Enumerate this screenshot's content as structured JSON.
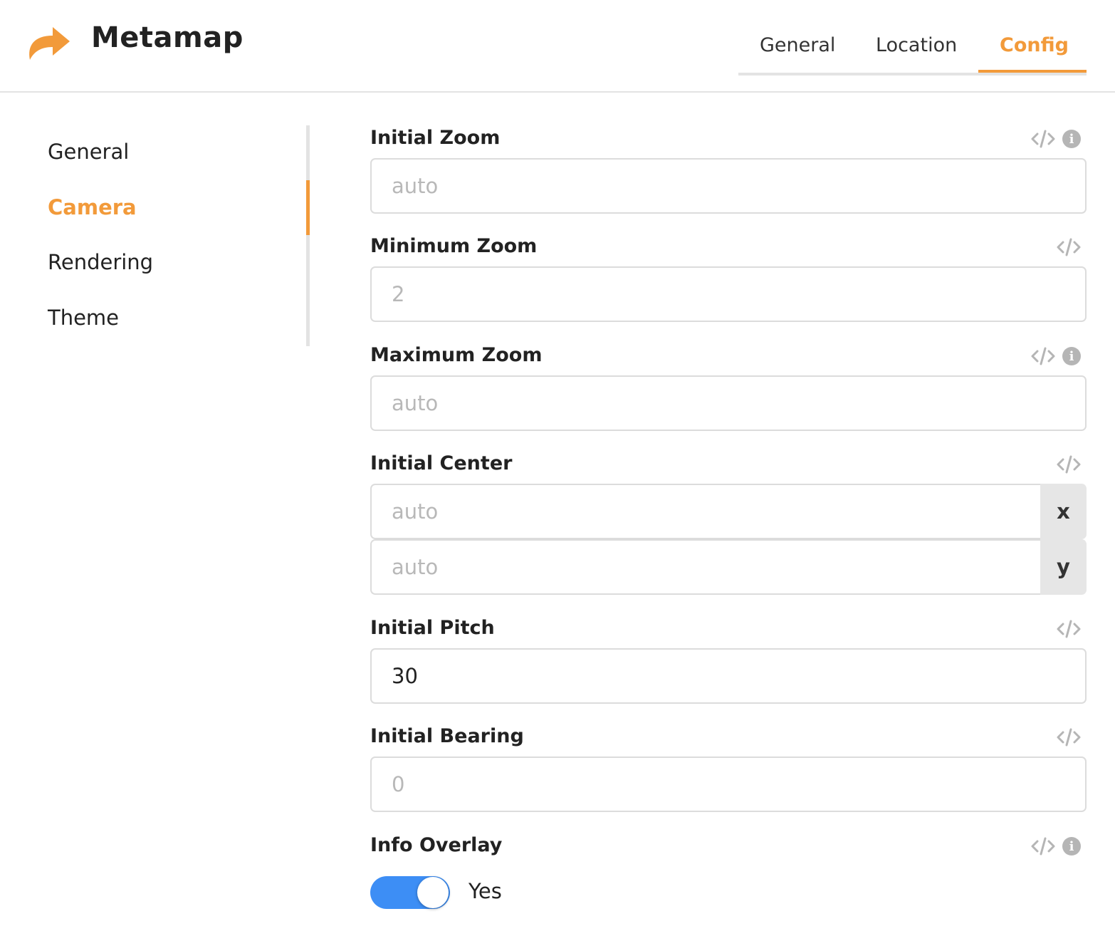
{
  "app": {
    "title": "Metamap",
    "logo_icon": "share-arrow-icon",
    "accent_color": "#f29a3a"
  },
  "tabs": [
    {
      "label": "General",
      "active": false
    },
    {
      "label": "Location",
      "active": false
    },
    {
      "label": "Config",
      "active": true
    }
  ],
  "sidebar": {
    "items": [
      {
        "label": "General",
        "active": false
      },
      {
        "label": "Camera",
        "active": true
      },
      {
        "label": "Rendering",
        "active": false
      },
      {
        "label": "Theme",
        "active": false
      }
    ]
  },
  "fields": {
    "initial_zoom": {
      "label": "Initial Zoom",
      "placeholder": "auto",
      "value": "",
      "has_info": true
    },
    "minimum_zoom": {
      "label": "Minimum Zoom",
      "placeholder": "2",
      "value": "",
      "has_info": false
    },
    "maximum_zoom": {
      "label": "Maximum Zoom",
      "placeholder": "auto",
      "value": "",
      "has_info": true
    },
    "initial_center": {
      "label": "Initial Center",
      "x": {
        "placeholder": "auto",
        "value": "",
        "suffix": "x"
      },
      "y": {
        "placeholder": "auto",
        "value": "",
        "suffix": "y"
      },
      "has_info": false
    },
    "initial_pitch": {
      "label": "Initial Pitch",
      "placeholder": "",
      "value": "30",
      "has_info": false
    },
    "initial_bearing": {
      "label": "Initial Bearing",
      "placeholder": "0",
      "value": "",
      "has_info": false
    },
    "info_overlay": {
      "label": "Info Overlay",
      "enabled": true,
      "toggle_text": "Yes",
      "has_info": true
    }
  },
  "icons": {
    "code": "code-icon",
    "info": "info-icon",
    "info_glyph": "i"
  },
  "colors": {
    "toggle_on": "#3d8ef5",
    "rail": "#e3e3e3"
  }
}
